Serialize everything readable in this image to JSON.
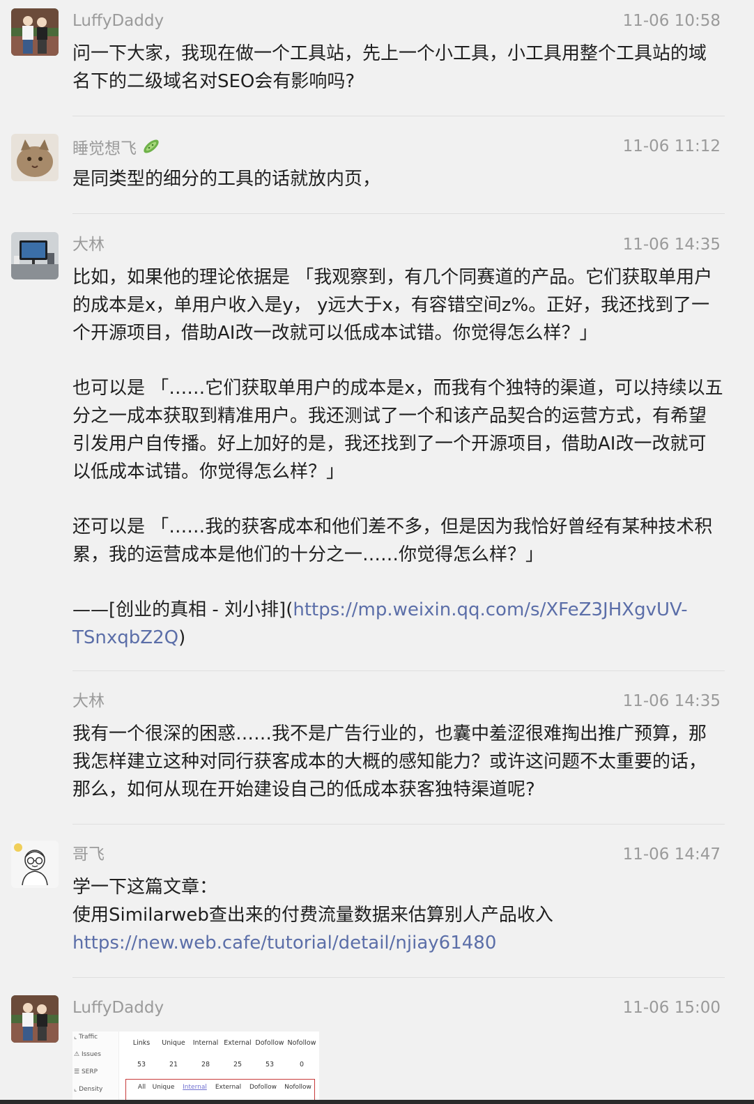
{
  "messages": [
    {
      "name": "LuffyDaddy",
      "time": "11-06 10:58",
      "avatar": "couple-photo",
      "paragraphs": [
        "问一下大家，我现在做一个工具站，先上一个小工具，小工具用整个工具站的域名下的二级域名对SEO会有影响吗?"
      ]
    },
    {
      "name": "睡觉想飞",
      "name_emoji": "cucumber-icon",
      "time": "11-06 11:12",
      "avatar": "cat-photo",
      "paragraphs": [
        "是同类型的细分的工具的话就放内页，"
      ]
    },
    {
      "name": "大林",
      "time": "11-06 14:35",
      "avatar": "desk-computer-photo",
      "paragraphs": [
        " 比如，如果他的理论依据是 「我观察到，有几个同赛道的产品。它们获取单用户的成本是x，单用户收入是y，  y远大于x，有容错空间z%。正好，我还找到了一个开源项目，借助AI改一改就可以低成本试错。你觉得怎么样？」",
        "也可以是 「……它们获取单用户的成本是x，而我有个独特的渠道，可以持续以五分之一成本获取到精准用户。我还测试了一个和该产品契合的运营方式，有希望引发用户自传播。好上加好的是，我还找到了一个开源项目，借助AI改一改就可以低成本试错。你觉得怎么样？」",
        "还可以是 「……我的获客成本和他们差不多，但是因为我恰好曾经有某种技术积累，我的运营成本是他们的十分之一……你觉得怎么样？」"
      ],
      "citation_prefix": "——[创业的真相 - 刘小排](",
      "citation_link": "https://mp.weixin.qq.com/s/XFeZ3JHXgvUV-TSnxqbZ2Q",
      "citation_suffix": ")"
    },
    {
      "name": "大林",
      "time": "11-06 14:35",
      "paragraphs": [
        "我有一个很深的困惑……我不是广告行业的，也囊中羞涩很难掏出推广预算，那我怎样建立这种对同行获客成本的大概的感知能力？或许这问题不太重要的话，那么，如何从现在开始建设自己的低成本获客独特渠道呢?"
      ]
    },
    {
      "name": "哥飞",
      "time": "11-06 14:47",
      "avatar": "glasses-cartoon",
      "line1": "学一下这篇文章：",
      "line2_text": "使用Similarweb查出来的付费流量数据来估算别人产品收入 ",
      "line2_link": "https://new.web.cafe/tutorial/detail/njiay61480"
    },
    {
      "name": "LuffyDaddy",
      "time": "11-06 15:00",
      "avatar": "couple-photo",
      "screenshot": {
        "sidebar": [
          "Traffic",
          "Issues",
          "SERP",
          "Density"
        ],
        "headers": [
          "Links",
          "Unique",
          "Internal",
          "External",
          "Dofollow",
          "Nofollow"
        ],
        "values": [
          "53",
          "21",
          "28",
          "25",
          "53",
          "0"
        ],
        "tabs": [
          "All",
          "Unique",
          "Internal",
          "External",
          "Dofollow",
          "Nofollow"
        ],
        "active_tab": "Internal"
      }
    }
  ],
  "colors": {
    "background": "#f1f1f1",
    "meta_text": "#9a9a9a",
    "link": "#5b6ea8",
    "divider": "#dedede"
  }
}
